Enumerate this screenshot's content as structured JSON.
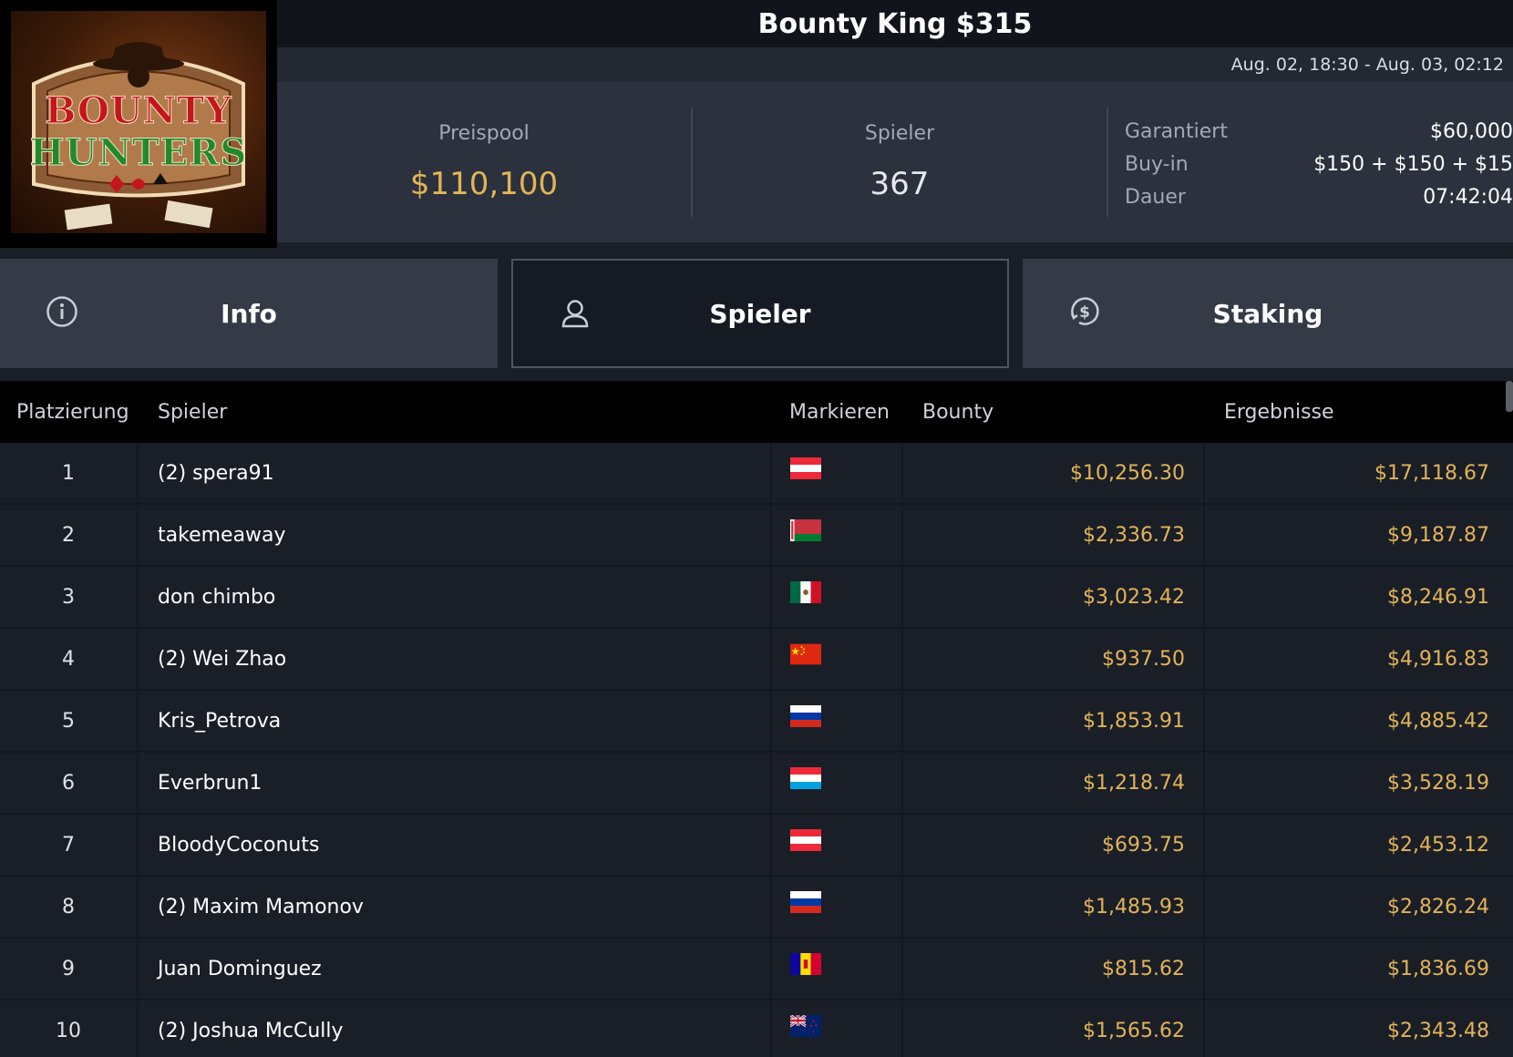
{
  "logo": {
    "line1": "BOUNTY",
    "line2": "HUNTERS"
  },
  "header": {
    "title": "Bounty King $315",
    "date_range": "Aug. 02, 18:30 - Aug. 03, 02:12"
  },
  "summary": {
    "prize_pool_label": "Preispool",
    "prize_pool_value": "$110,100",
    "players_label": "Spieler",
    "players_value": "367",
    "details": [
      {
        "label": "Garantiert",
        "value": "$60,000"
      },
      {
        "label": "Buy-in",
        "value": "$150 + $150 + $15"
      },
      {
        "label": "Dauer",
        "value": "07:42:04"
      }
    ]
  },
  "tabs": [
    {
      "label": "Info",
      "icon": "info-icon",
      "active": false
    },
    {
      "label": "Spieler",
      "icon": "user-icon",
      "active": true
    },
    {
      "label": "Staking",
      "icon": "dollar-coin-icon",
      "active": false
    }
  ],
  "table": {
    "headers": {
      "place": "Platzierung",
      "player": "Spieler",
      "mark": "Markieren",
      "bounty": "Bounty",
      "results": "Ergebnisse"
    },
    "rows": [
      {
        "place": "1",
        "player": "(2) spera91",
        "flag": "austria-flag",
        "bounty": "$10,256.30",
        "result": "$17,118.67"
      },
      {
        "place": "2",
        "player": "takemeaway",
        "flag": "belarus-flag",
        "bounty": "$2,336.73",
        "result": "$9,187.87"
      },
      {
        "place": "3",
        "player": "don chimbo",
        "flag": "mexico-flag",
        "bounty": "$3,023.42",
        "result": "$8,246.91"
      },
      {
        "place": "4",
        "player": "(2) Wei Zhao",
        "flag": "china-flag",
        "bounty": "$937.50",
        "result": "$4,916.83"
      },
      {
        "place": "5",
        "player": "Kris_Petrova",
        "flag": "russia-flag",
        "bounty": "$1,853.91",
        "result": "$4,885.42"
      },
      {
        "place": "6",
        "player": "Everbrun1",
        "flag": "luxembourg-flag",
        "bounty": "$1,218.74",
        "result": "$3,528.19"
      },
      {
        "place": "7",
        "player": "BloodyCoconuts",
        "flag": "austria-flag",
        "bounty": "$693.75",
        "result": "$2,453.12"
      },
      {
        "place": "8",
        "player": "(2) Maxim Mamonov",
        "flag": "russia-flag",
        "bounty": "$1,485.93",
        "result": "$2,826.24"
      },
      {
        "place": "9",
        "player": "Juan Dominguez",
        "flag": "andorra-flag",
        "bounty": "$815.62",
        "result": "$1,836.69"
      },
      {
        "place": "10",
        "player": "(2) Joshua McCully",
        "flag": "new-zealand-flag",
        "bounty": "$1,565.62",
        "result": "$2,343.48"
      }
    ]
  },
  "colors": {
    "accent_gold": "#e2b457",
    "background": "#1a1e27",
    "panel": "#2b313d",
    "tab": "#343b47"
  }
}
